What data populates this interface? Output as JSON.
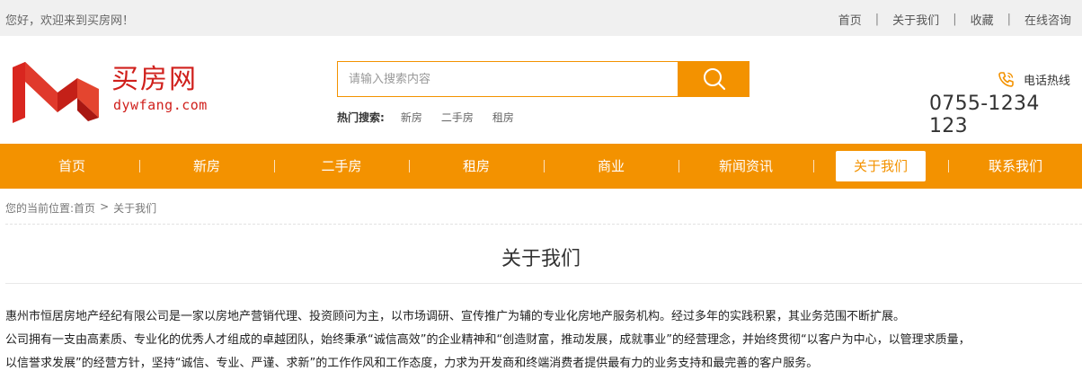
{
  "topbar": {
    "welcome": "您好，欢迎来到买房网！",
    "links": [
      "首页",
      "关于我们",
      "收藏",
      "在线咨询"
    ],
    "separator": "|"
  },
  "logo": {
    "cn": "买房网",
    "en": "dywfang.com"
  },
  "search": {
    "placeholder": "请输入搜索内容",
    "value": "",
    "icon": "search-icon"
  },
  "hot": {
    "label": "热门搜索:",
    "items": [
      "新房",
      "二手房",
      "租房"
    ]
  },
  "hotline": {
    "label": "电话热线",
    "number": "0755-1234 123",
    "icon": "phone-icon"
  },
  "nav": {
    "items": [
      "首页",
      "新房",
      "二手房",
      "租房",
      "商业",
      "新闻资讯",
      "关于我们",
      "联系我们"
    ],
    "active": "关于我们"
  },
  "breadcrumb": {
    "prefix": "您的当前位置:",
    "home": "首页",
    "arrow": ">",
    "current": "关于我们"
  },
  "page": {
    "title": "关于我们",
    "paragraphs": [
      "惠州市恒居房地产经纪有限公司是一家以房地产营销代理、投资顾问为主，以市场调研、宣传推广为辅的专业化房地产服务机构。经过多年的实践积累，其业务范围不断扩展。",
      "公司拥有一支由高素质、专业化的优秀人才组成的卓越团队，始终秉承“诚信高效”的企业精神和“创造财富，推动发展，成就事业”的经营理念，并始终贯彻“以客户为中心，以管理求质量，",
      "以信誉求发展”的经营方针，坚持“诚信、专业、严谨、求新”的工作作风和工作态度，力求为开发商和终端消费者提供最有力的业务支持和最完善的客户服务。"
    ]
  },
  "colors": {
    "accent": "#f39200",
    "brand": "#d0201c"
  }
}
